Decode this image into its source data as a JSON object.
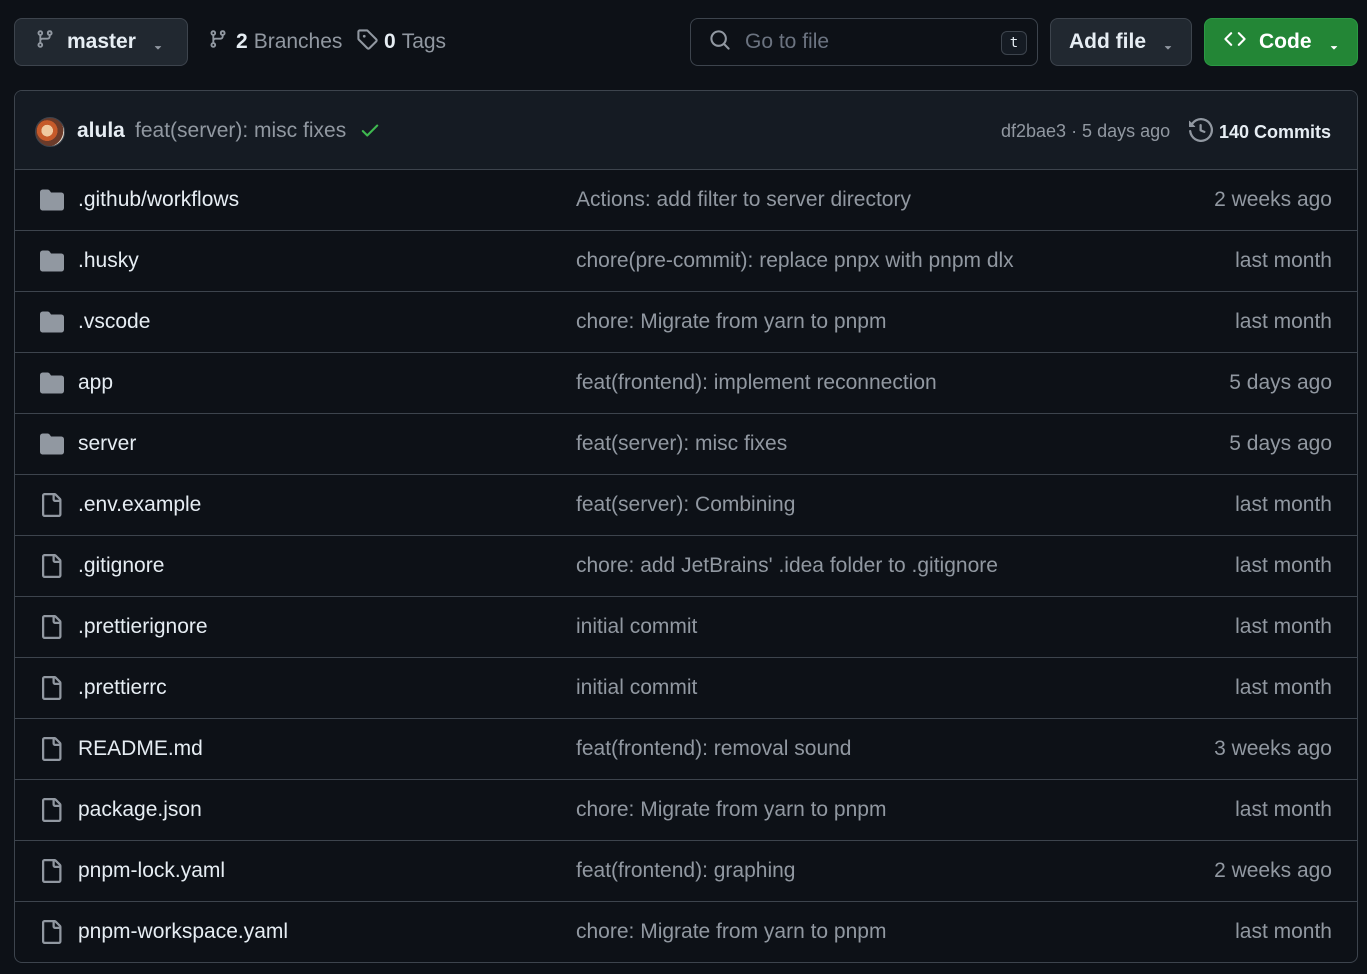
{
  "toolbar": {
    "branch": "master",
    "branches_count": "2",
    "branches_label": "Branches",
    "tags_count": "0",
    "tags_label": "Tags",
    "search_placeholder": "Go to file",
    "search_shortcut": "t",
    "add_file_label": "Add file",
    "code_label": "Code"
  },
  "latest_commit": {
    "author": "alula",
    "message": "feat(server): misc fixes",
    "status": "success",
    "meta": "df2bae3 · 5 days ago",
    "commits_label": "140 Commits"
  },
  "colors": {
    "background": "#0d1117",
    "accent_green": "#238636",
    "check_green": "#3fb950",
    "folder_icon": "#9198a1"
  },
  "files": [
    {
      "type": "folder",
      "name": ".github/workflows",
      "message": "Actions: add filter to server directory",
      "date": "2 weeks ago"
    },
    {
      "type": "folder",
      "name": ".husky",
      "message": "chore(pre-commit): replace pnpx with pnpm dlx",
      "date": "last month"
    },
    {
      "type": "folder",
      "name": ".vscode",
      "message": "chore: Migrate from yarn to pnpm",
      "date": "last month"
    },
    {
      "type": "folder",
      "name": "app",
      "message": "feat(frontend): implement reconnection",
      "date": "5 days ago"
    },
    {
      "type": "folder",
      "name": "server",
      "message": "feat(server): misc fixes",
      "date": "5 days ago"
    },
    {
      "type": "file",
      "name": ".env.example",
      "message": "feat(server): Combining",
      "date": "last month"
    },
    {
      "type": "file",
      "name": ".gitignore",
      "message": "chore: add JetBrains' .idea folder to .gitignore",
      "date": "last month"
    },
    {
      "type": "file",
      "name": ".prettierignore",
      "message": "initial commit",
      "date": "last month"
    },
    {
      "type": "file",
      "name": ".prettierrc",
      "message": "initial commit",
      "date": "last month"
    },
    {
      "type": "file",
      "name": "README.md",
      "message": "feat(frontend): removal sound",
      "date": "3 weeks ago"
    },
    {
      "type": "file",
      "name": "package.json",
      "message": "chore: Migrate from yarn to pnpm",
      "date": "last month"
    },
    {
      "type": "file",
      "name": "pnpm-lock.yaml",
      "message": "feat(frontend): graphing",
      "date": "2 weeks ago"
    },
    {
      "type": "file",
      "name": "pnpm-workspace.yaml",
      "message": "chore: Migrate from yarn to pnpm",
      "date": "last month"
    }
  ]
}
